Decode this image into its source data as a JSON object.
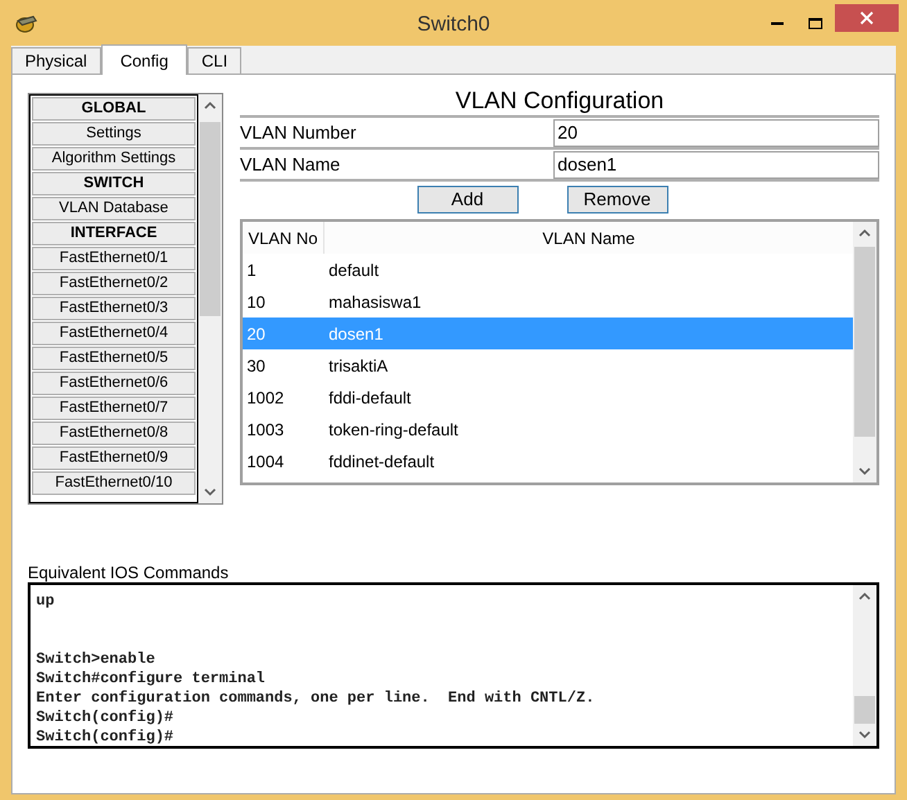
{
  "window": {
    "title": "Switch0"
  },
  "tabs": [
    {
      "label": "Physical",
      "selected": false
    },
    {
      "label": "Config",
      "selected": true
    },
    {
      "label": "CLI",
      "selected": false
    }
  ],
  "sidebar": {
    "items": [
      {
        "label": "GLOBAL",
        "kind": "header"
      },
      {
        "label": "Settings",
        "kind": "item"
      },
      {
        "label": "Algorithm Settings",
        "kind": "item"
      },
      {
        "label": "SWITCH",
        "kind": "header"
      },
      {
        "label": "VLAN Database",
        "kind": "item"
      },
      {
        "label": "INTERFACE",
        "kind": "header"
      },
      {
        "label": "FastEthernet0/1",
        "kind": "item"
      },
      {
        "label": "FastEthernet0/2",
        "kind": "item"
      },
      {
        "label": "FastEthernet0/3",
        "kind": "item"
      },
      {
        "label": "FastEthernet0/4",
        "kind": "item"
      },
      {
        "label": "FastEthernet0/5",
        "kind": "item"
      },
      {
        "label": "FastEthernet0/6",
        "kind": "item"
      },
      {
        "label": "FastEthernet0/7",
        "kind": "item"
      },
      {
        "label": "FastEthernet0/8",
        "kind": "item"
      },
      {
        "label": "FastEthernet0/9",
        "kind": "item"
      },
      {
        "label": "FastEthernet0/10",
        "kind": "item"
      }
    ]
  },
  "vlan_config": {
    "title": "VLAN Configuration",
    "fields": [
      {
        "label": "VLAN Number",
        "value": "20"
      },
      {
        "label": "VLAN Name",
        "value": "dosen1"
      }
    ],
    "buttons": [
      "Add",
      "Remove"
    ],
    "table": {
      "columns": [
        "VLAN No",
        "VLAN Name"
      ],
      "rows": [
        {
          "cells": [
            "1",
            "default"
          ],
          "selected": false
        },
        {
          "cells": [
            "10",
            "mahasiswa1"
          ],
          "selected": false
        },
        {
          "cells": [
            "20",
            "dosen1"
          ],
          "selected": true
        },
        {
          "cells": [
            "30",
            "trisaktiA"
          ],
          "selected": false
        },
        {
          "cells": [
            "1002",
            "fddi-default"
          ],
          "selected": false
        },
        {
          "cells": [
            "1003",
            "token-ring-default"
          ],
          "selected": false
        },
        {
          "cells": [
            "1004",
            "fddinet-default"
          ],
          "selected": false
        }
      ]
    }
  },
  "console": {
    "label": "Equivalent IOS Commands",
    "blocks": [
      [
        "up"
      ],
      [
        "Switch>enable",
        "Switch#configure terminal",
        "Enter configuration commands, one per line.  End with CNTL/Z.",
        "Switch(config)#",
        "Switch(config)#"
      ]
    ]
  }
}
